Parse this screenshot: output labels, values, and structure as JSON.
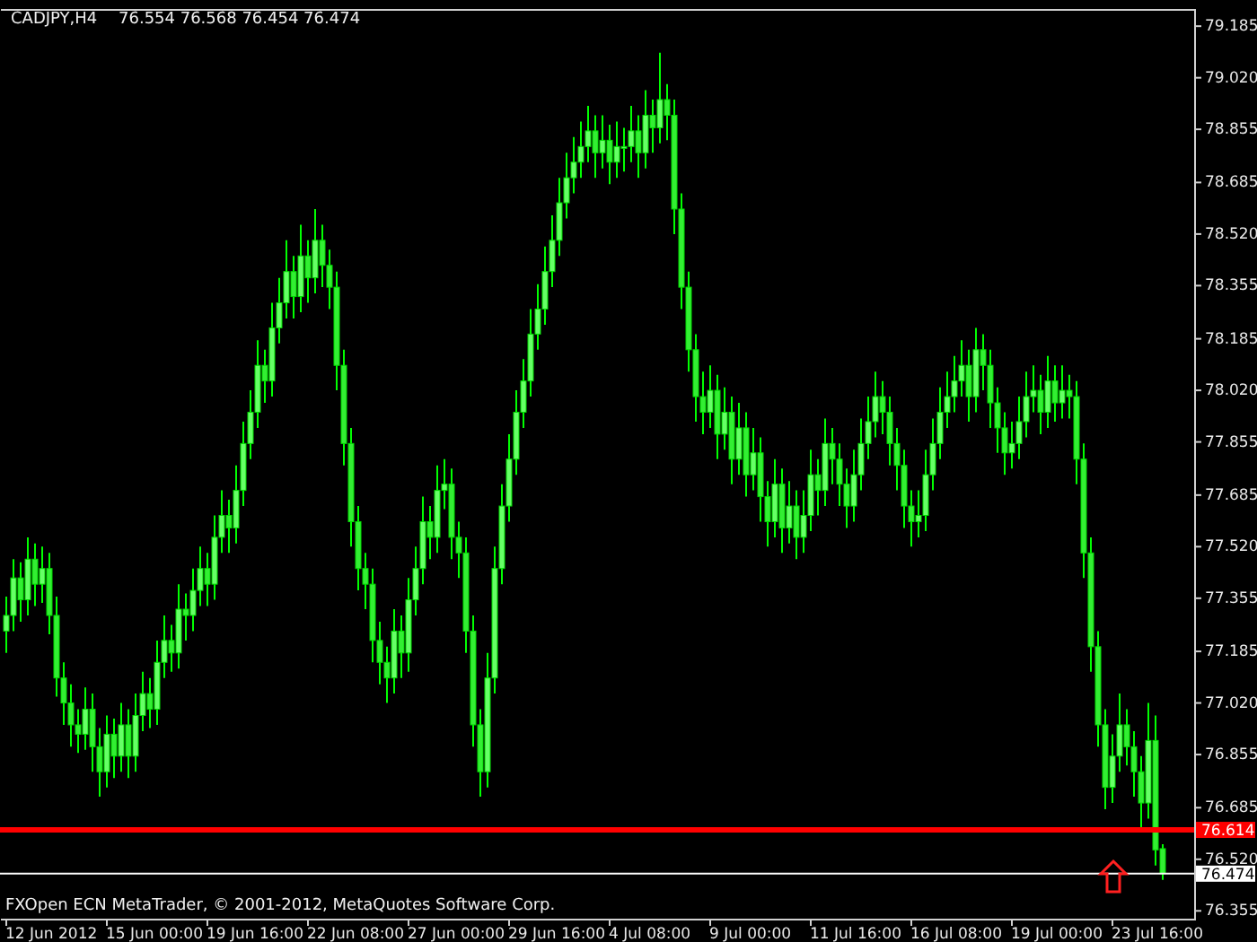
{
  "header": {
    "symbol": "CADJPY,H4",
    "ohlc": "76.554 76.568 76.454 76.474"
  },
  "chart_data": {
    "type": "candlestick",
    "ylim": [
      76.33,
      79.24
    ],
    "ref_lines": [
      {
        "axis": "y",
        "value": 76.614,
        "label": "76.614",
        "color": "#ff0000"
      },
      {
        "axis": "y",
        "value": 76.474,
        "label": "76.474",
        "color": "#ffffff"
      }
    ],
    "yticks": [
      {
        "value": 79.185,
        "label": "79.185"
      },
      {
        "value": 79.02,
        "label": "79.020"
      },
      {
        "value": 78.855,
        "label": "78.855"
      },
      {
        "value": 78.685,
        "label": "78.685"
      },
      {
        "value": 78.52,
        "label": "78.520"
      },
      {
        "value": 78.355,
        "label": "78.355"
      },
      {
        "value": 78.185,
        "label": "78.185"
      },
      {
        "value": 78.02,
        "label": "78.020"
      },
      {
        "value": 77.855,
        "label": "77.855"
      },
      {
        "value": 77.685,
        "label": "77.685"
      },
      {
        "value": 77.52,
        "label": "77.520"
      },
      {
        "value": 77.355,
        "label": "77.355"
      },
      {
        "value": 77.185,
        "label": "77.185"
      },
      {
        "value": 77.02,
        "label": "77.020"
      },
      {
        "value": 76.855,
        "label": "76.855"
      },
      {
        "value": 76.685,
        "label": "76.685"
      },
      {
        "value": 76.52,
        "label": "76.520"
      },
      {
        "value": 76.355,
        "label": "76.355"
      }
    ],
    "ohlc": [
      [
        77.25,
        77.36,
        77.18,
        77.3
      ],
      [
        77.3,
        77.48,
        77.25,
        77.42
      ],
      [
        77.42,
        77.47,
        77.28,
        77.35
      ],
      [
        77.35,
        77.55,
        77.3,
        77.48
      ],
      [
        77.48,
        77.53,
        77.33,
        77.4
      ],
      [
        77.4,
        77.52,
        77.34,
        77.45
      ],
      [
        77.45,
        77.5,
        77.24,
        77.3
      ],
      [
        77.3,
        77.36,
        77.04,
        77.1
      ],
      [
        77.1,
        77.15,
        76.95,
        77.02
      ],
      [
        77.02,
        77.08,
        76.88,
        76.95
      ],
      [
        76.95,
        77.0,
        76.86,
        76.92
      ],
      [
        76.92,
        77.07,
        76.87,
        77.0
      ],
      [
        77.0,
        77.05,
        76.8,
        76.88
      ],
      [
        76.88,
        76.94,
        76.72,
        76.8
      ],
      [
        76.8,
        76.98,
        76.75,
        76.92
      ],
      [
        76.92,
        76.97,
        76.78,
        76.85
      ],
      [
        76.85,
        77.02,
        76.8,
        76.95
      ],
      [
        76.95,
        77.0,
        76.78,
        76.85
      ],
      [
        76.85,
        77.05,
        76.8,
        76.98
      ],
      [
        76.98,
        77.12,
        76.93,
        77.05
      ],
      [
        77.05,
        77.1,
        76.94,
        77.0
      ],
      [
        77.0,
        77.22,
        76.95,
        77.15
      ],
      [
        77.15,
        77.3,
        77.1,
        77.22
      ],
      [
        77.22,
        77.27,
        77.12,
        77.18
      ],
      [
        77.18,
        77.4,
        77.13,
        77.32
      ],
      [
        77.32,
        77.37,
        77.22,
        77.3
      ],
      [
        77.3,
        77.45,
        77.25,
        77.38
      ],
      [
        77.38,
        77.52,
        77.33,
        77.45
      ],
      [
        77.45,
        77.5,
        77.33,
        77.4
      ],
      [
        77.4,
        77.62,
        77.35,
        77.55
      ],
      [
        77.55,
        77.7,
        77.5,
        77.62
      ],
      [
        77.62,
        77.67,
        77.5,
        77.58
      ],
      [
        77.58,
        77.78,
        77.53,
        77.7
      ],
      [
        77.7,
        77.92,
        77.65,
        77.85
      ],
      [
        77.85,
        78.02,
        77.8,
        77.95
      ],
      [
        77.95,
        78.18,
        77.9,
        78.1
      ],
      [
        78.1,
        78.15,
        77.98,
        78.05
      ],
      [
        78.05,
        78.3,
        78.0,
        78.22
      ],
      [
        78.22,
        78.38,
        78.17,
        78.3
      ],
      [
        78.3,
        78.5,
        78.25,
        78.4
      ],
      [
        78.4,
        78.45,
        78.25,
        78.32
      ],
      [
        78.32,
        78.55,
        78.27,
        78.45
      ],
      [
        78.45,
        78.5,
        78.3,
        78.38
      ],
      [
        78.38,
        78.6,
        78.33,
        78.5
      ],
      [
        78.5,
        78.55,
        78.35,
        78.42
      ],
      [
        78.42,
        78.47,
        78.28,
        78.35
      ],
      [
        78.35,
        78.4,
        78.02,
        78.1
      ],
      [
        78.1,
        78.15,
        77.78,
        77.85
      ],
      [
        77.85,
        77.9,
        77.52,
        77.6
      ],
      [
        77.6,
        77.65,
        77.38,
        77.45
      ],
      [
        77.45,
        77.5,
        77.32,
        77.4
      ],
      [
        77.4,
        77.45,
        77.15,
        77.22
      ],
      [
        77.22,
        77.28,
        77.08,
        77.15
      ],
      [
        77.15,
        77.2,
        77.02,
        77.1
      ],
      [
        77.1,
        77.32,
        77.05,
        77.25
      ],
      [
        77.25,
        77.3,
        77.1,
        77.18
      ],
      [
        77.18,
        77.42,
        77.12,
        77.35
      ],
      [
        77.35,
        77.52,
        77.3,
        77.45
      ],
      [
        77.45,
        77.68,
        77.4,
        77.6
      ],
      [
        77.6,
        77.65,
        77.48,
        77.55
      ],
      [
        77.55,
        77.78,
        77.5,
        77.7
      ],
      [
        77.7,
        77.8,
        77.64,
        77.72
      ],
      [
        77.72,
        77.77,
        77.48,
        77.55
      ],
      [
        77.55,
        77.6,
        77.42,
        77.5
      ],
      [
        77.5,
        77.55,
        77.18,
        77.25
      ],
      [
        77.25,
        77.3,
        76.88,
        76.95
      ],
      [
        76.95,
        77.0,
        76.72,
        76.8
      ],
      [
        76.8,
        77.18,
        76.75,
        77.1
      ],
      [
        77.1,
        77.52,
        77.05,
        77.45
      ],
      [
        77.45,
        77.72,
        77.4,
        77.65
      ],
      [
        77.65,
        77.88,
        77.6,
        77.8
      ],
      [
        77.8,
        78.02,
        77.75,
        77.95
      ],
      [
        77.95,
        78.12,
        77.9,
        78.05
      ],
      [
        78.05,
        78.28,
        78.0,
        78.2
      ],
      [
        78.2,
        78.36,
        78.15,
        78.28
      ],
      [
        78.28,
        78.48,
        78.23,
        78.4
      ],
      [
        78.4,
        78.58,
        78.35,
        78.5
      ],
      [
        78.5,
        78.7,
        78.45,
        78.62
      ],
      [
        78.62,
        78.78,
        78.57,
        78.7
      ],
      [
        78.7,
        78.83,
        78.65,
        78.75
      ],
      [
        78.75,
        78.88,
        78.7,
        78.8
      ],
      [
        78.8,
        78.93,
        78.75,
        78.85
      ],
      [
        78.85,
        78.9,
        78.7,
        78.78
      ],
      [
        78.78,
        78.9,
        78.73,
        78.82
      ],
      [
        78.82,
        78.87,
        78.68,
        78.75
      ],
      [
        78.75,
        78.88,
        78.7,
        78.8
      ],
      [
        78.8,
        78.86,
        78.72,
        78.8
      ],
      [
        78.8,
        78.93,
        78.75,
        78.85
      ],
      [
        78.85,
        78.9,
        78.7,
        78.78
      ],
      [
        78.78,
        78.98,
        78.73,
        78.9
      ],
      [
        78.9,
        78.95,
        78.78,
        78.86
      ],
      [
        78.86,
        79.1,
        78.81,
        78.95
      ],
      [
        78.95,
        79.0,
        78.82,
        78.9
      ],
      [
        78.9,
        78.95,
        78.52,
        78.6
      ],
      [
        78.6,
        78.65,
        78.28,
        78.35
      ],
      [
        78.35,
        78.4,
        78.08,
        78.15
      ],
      [
        78.15,
        78.2,
        77.92,
        78.0
      ],
      [
        78.0,
        78.08,
        77.88,
        77.95
      ],
      [
        77.95,
        78.1,
        77.9,
        78.02
      ],
      [
        78.02,
        78.07,
        77.8,
        77.88
      ],
      [
        77.88,
        78.03,
        77.83,
        77.95
      ],
      [
        77.95,
        78.0,
        77.72,
        77.8
      ],
      [
        77.8,
        77.98,
        77.75,
        77.9
      ],
      [
        77.9,
        77.95,
        77.68,
        77.75
      ],
      [
        77.75,
        77.9,
        77.7,
        77.82
      ],
      [
        77.82,
        77.87,
        77.6,
        77.68
      ],
      [
        77.68,
        77.73,
        77.52,
        77.6
      ],
      [
        77.6,
        77.8,
        77.55,
        77.72
      ],
      [
        77.72,
        77.77,
        77.5,
        77.58
      ],
      [
        77.58,
        77.73,
        77.53,
        77.65
      ],
      [
        77.65,
        77.7,
        77.48,
        77.55
      ],
      [
        77.55,
        77.7,
        77.5,
        77.62
      ],
      [
        77.62,
        77.83,
        77.57,
        77.75
      ],
      [
        77.75,
        77.8,
        77.62,
        77.7
      ],
      [
        77.7,
        77.93,
        77.65,
        77.85
      ],
      [
        77.85,
        77.9,
        77.72,
        77.8
      ],
      [
        77.8,
        77.85,
        77.65,
        77.72
      ],
      [
        77.72,
        77.77,
        77.58,
        77.65
      ],
      [
        77.65,
        77.83,
        77.6,
        77.75
      ],
      [
        77.75,
        77.93,
        77.7,
        77.85
      ],
      [
        77.85,
        78.0,
        77.8,
        77.92
      ],
      [
        77.92,
        78.08,
        77.87,
        78.0
      ],
      [
        78.0,
        78.05,
        77.88,
        77.95
      ],
      [
        77.95,
        78.0,
        77.78,
        77.85
      ],
      [
        77.85,
        77.9,
        77.7,
        77.78
      ],
      [
        77.78,
        77.83,
        77.58,
        77.65
      ],
      [
        77.65,
        77.7,
        77.52,
        77.6
      ],
      [
        77.6,
        77.7,
        77.55,
        77.62
      ],
      [
        77.62,
        77.83,
        77.57,
        77.75
      ],
      [
        77.75,
        77.93,
        77.7,
        77.85
      ],
      [
        77.85,
        78.03,
        77.8,
        77.95
      ],
      [
        77.95,
        78.08,
        77.9,
        78.0
      ],
      [
        78.0,
        78.13,
        77.95,
        78.05
      ],
      [
        78.05,
        78.18,
        78.0,
        78.1
      ],
      [
        78.1,
        78.15,
        77.92,
        78.0
      ],
      [
        78.0,
        78.22,
        77.95,
        78.15
      ],
      [
        78.15,
        78.2,
        78.02,
        78.1
      ],
      [
        78.1,
        78.15,
        77.9,
        77.98
      ],
      [
        77.98,
        78.03,
        77.82,
        77.9
      ],
      [
        77.9,
        77.95,
        77.75,
        77.82
      ],
      [
        77.82,
        77.92,
        77.77,
        77.85
      ],
      [
        77.85,
        78.0,
        77.8,
        77.92
      ],
      [
        77.92,
        78.08,
        77.87,
        78.0
      ],
      [
        78.0,
        78.1,
        77.95,
        78.02
      ],
      [
        78.02,
        78.07,
        77.88,
        77.95
      ],
      [
        77.95,
        78.13,
        77.9,
        78.05
      ],
      [
        78.05,
        78.1,
        77.92,
        77.98
      ],
      [
        77.98,
        78.1,
        77.93,
        78.02
      ],
      [
        78.02,
        78.07,
        77.93,
        78.0
      ],
      [
        78.0,
        78.05,
        77.72,
        77.8
      ],
      [
        77.8,
        77.85,
        77.42,
        77.5
      ],
      [
        77.5,
        77.55,
        77.12,
        77.2
      ],
      [
        77.2,
        77.25,
        76.88,
        76.95
      ],
      [
        76.95,
        77.0,
        76.68,
        76.75
      ],
      [
        76.75,
        76.92,
        76.7,
        76.85
      ],
      [
        76.85,
        77.05,
        76.8,
        76.95
      ],
      [
        76.95,
        77.0,
        76.82,
        76.88
      ],
      [
        76.88,
        76.93,
        76.72,
        76.8
      ],
      [
        76.8,
        76.85,
        76.62,
        76.7
      ],
      [
        76.7,
        77.02,
        76.65,
        76.9
      ],
      [
        76.9,
        76.98,
        76.5,
        76.55
      ],
      [
        76.554,
        76.568,
        76.454,
        76.474
      ]
    ]
  },
  "time_axis": {
    "ticks": [
      "12 Jun 2012",
      "15 Jun 00:00",
      "19 Jun 16:00",
      "22 Jun 08:00",
      "27 Jun 00:00",
      "29 Jun 16:00",
      "4 Jul 08:00",
      "9 Jul 00:00",
      "11 Jul 16:00",
      "16 Jul 08:00",
      "19 Jul 00:00",
      "23 Jul 16:00"
    ]
  },
  "footer": "FXOpen ECN MetaTrader, © 2001-2012, MetaQuotes Software Corp."
}
